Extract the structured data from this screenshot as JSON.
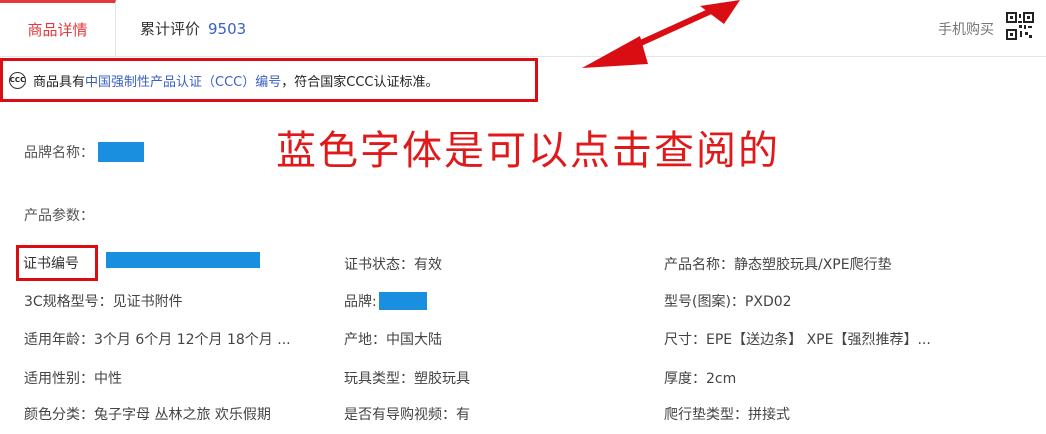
{
  "tabs": {
    "details_label": "商品详情",
    "reviews_label": "累计评价",
    "reviews_count": "9503",
    "mobile_buy": "手机购买"
  },
  "ccc_notice": {
    "prefix": "商品具有",
    "link": "中国强制性产品认证（CCC）编号",
    "suffix": "，符合国家CCC认证标准。"
  },
  "annotation": "蓝色字体是可以点击查阅的",
  "brand_name_label": "品牌名称：",
  "params_title": "产品参数：",
  "params": {
    "cert_no": "证书编号",
    "cert_status": "证书状态：有效",
    "product_name": "产品名称：静态塑胶玩具/XPE爬行垫",
    "model_3c": "3C规格型号：见证书附件",
    "brand": "品牌:",
    "model_no": "型号(图案)：PXD02",
    "age": "适用年龄：3个月 6个月 12个月 18个月 ...",
    "origin": "产地：中国大陆",
    "size": "尺寸：EPE【送边条】 XPE【强烈推荐】...",
    "gender": "适用性别：中性",
    "toy_type": "玩具类型：塑胶玩具",
    "thickness": "厚度：2cm",
    "color": "颜色分类：兔子字母 丛林之旅 欢乐假期",
    "video": "是否有导购视频：有",
    "mat_type": "爬行垫类型：拼接式"
  },
  "colors": {
    "accent": "#e4393c",
    "link": "#3a5fc5",
    "annotation": "#e01a1a",
    "redaction": "#1a8fe0"
  }
}
